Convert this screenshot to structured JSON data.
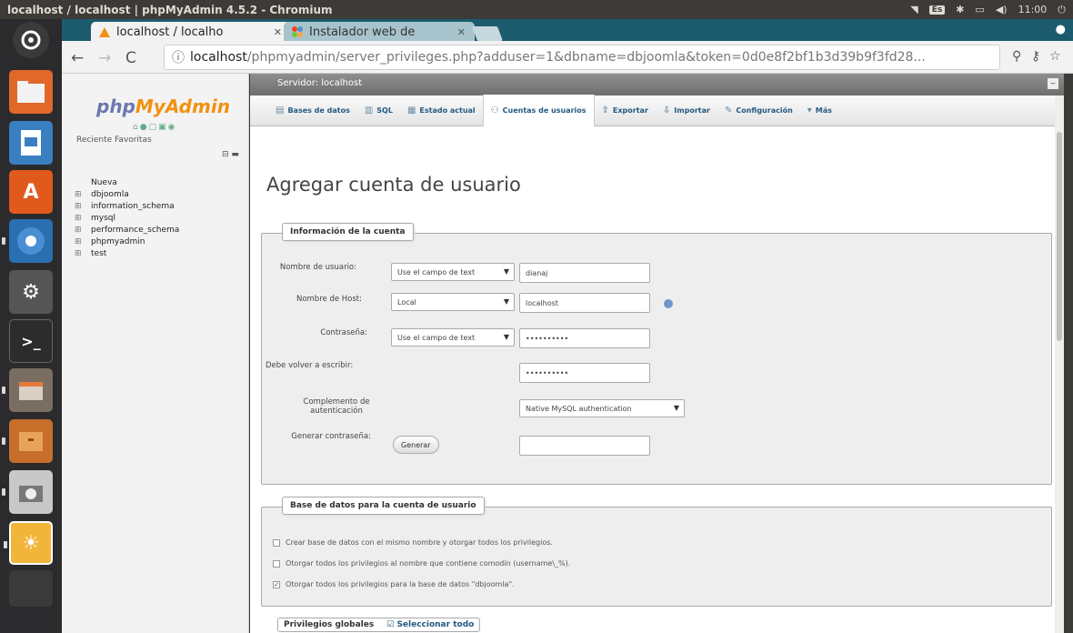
{
  "window": {
    "title": "localhost / localhost | phpMyAdmin 4.5.2 - Chromium",
    "clock": "11:00",
    "keyboard": "Es"
  },
  "browser": {
    "tabs": [
      {
        "label": "localhost / localho",
        "active": true
      },
      {
        "label": "Instalador web de",
        "active": false
      }
    ],
    "url_host": "localhost",
    "url_path": "/phpmyadmin/server_privileges.php?adduser=1&dbname=dbjoomla&token=0d0e8f2bf1b3d39b9f3fd28..."
  },
  "nav": {
    "logo_php": "php",
    "logo_myadmin": "MyAdmin",
    "recent_tab": "Reciente",
    "favorites_tab": "Favoritas",
    "tree": [
      {
        "label": "Nueva",
        "expander": ""
      },
      {
        "label": "dbjoomla",
        "expander": "⊞"
      },
      {
        "label": "information_schema",
        "expander": "⊞"
      },
      {
        "label": "mysql",
        "expander": "⊞"
      },
      {
        "label": "performance_schema",
        "expander": "⊞"
      },
      {
        "label": "phpmyadmin",
        "expander": "⊞"
      },
      {
        "label": "test",
        "expander": "⊞"
      }
    ]
  },
  "main": {
    "server_label": "Servidor: localhost",
    "menu": [
      {
        "label": "Bases de datos",
        "icon": "database-icon",
        "glyph": "▤"
      },
      {
        "label": "SQL",
        "icon": "sql-icon",
        "glyph": "▥"
      },
      {
        "label": "Estado actual",
        "icon": "status-icon",
        "glyph": "▦"
      },
      {
        "label": "Cuentas de usuarios",
        "icon": "users-icon",
        "glyph": "⚇",
        "active": true
      },
      {
        "label": "Exportar",
        "icon": "export-icon",
        "glyph": "⇪"
      },
      {
        "label": "Importar",
        "icon": "import-icon",
        "glyph": "⇩"
      },
      {
        "label": "Configuración",
        "icon": "settings-icon",
        "glyph": "✎"
      },
      {
        "label": "Más",
        "icon": "more-icon",
        "glyph": "▾"
      }
    ],
    "page_title": "Agregar cuenta de usuario",
    "account": {
      "legend": "Información de la cuenta",
      "username_label": "Nombre de usuario:",
      "username_mode": "Use el campo de text",
      "username_value": "dianaj",
      "host_label": "Nombre de Host:",
      "host_mode": "Local",
      "host_value": "localhost",
      "password_label": "Contraseña:",
      "password_mode": "Use el campo de text",
      "password_value": "••••••••••",
      "retype_label": "Debe volver a escribir:",
      "retype_value": "••••••••••",
      "auth_label_1": "Complemento de",
      "auth_label_2": "autenticación",
      "auth_value": "Native MySQL authentication",
      "generate_label": "Generar contraseña:",
      "generate_button": "Generar"
    },
    "database": {
      "legend": "Base de datos para la cuenta de usuario",
      "options": [
        {
          "label": "Crear base de datos con el mismo nombre y otorgar todos los privilegios.",
          "checked": false
        },
        {
          "label": "Otorgar todos los privilegios al nombre que contiene comodín (username\\_%).",
          "checked": false
        },
        {
          "label": "Otorgar todos los privilegios para la base de datos \"dbjoomla\".",
          "checked": true
        }
      ]
    },
    "global": {
      "legend": "Privilegios globales",
      "select_all": "Seleccionar todo"
    }
  }
}
